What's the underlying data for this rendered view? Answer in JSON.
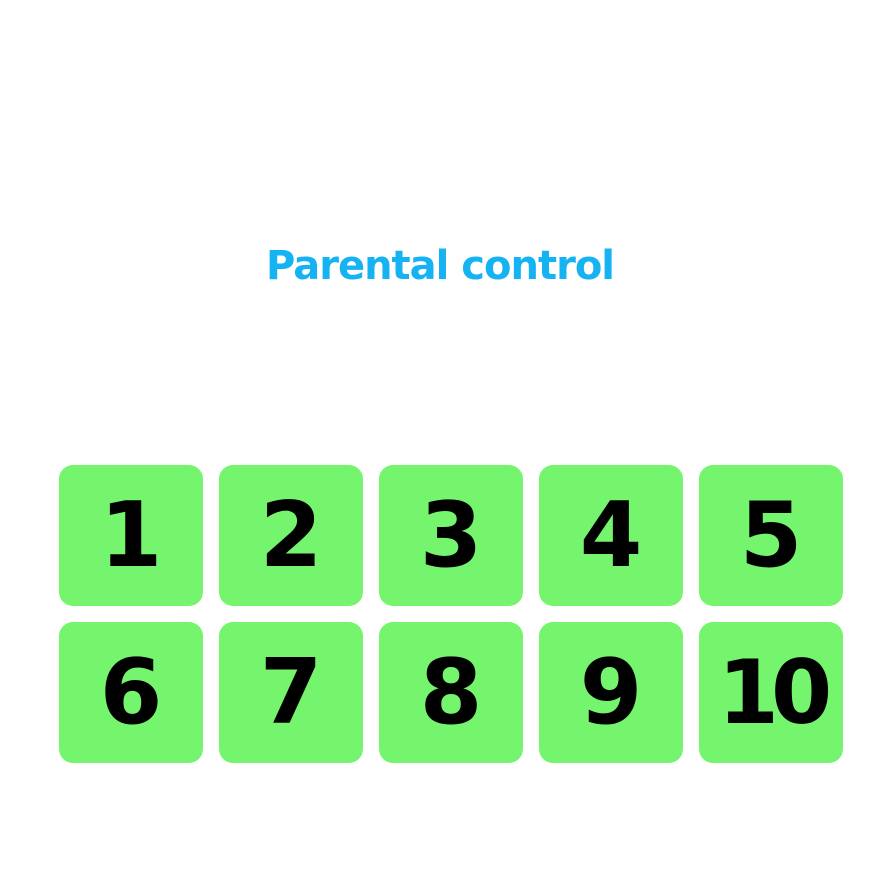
{
  "page": {
    "title": "Parental control"
  },
  "colors": {
    "title": "#16b3f3",
    "key_background": "#74f56d",
    "key_label": "#000000",
    "background": "#ffffff"
  },
  "keypad": {
    "keys": [
      {
        "label": "1"
      },
      {
        "label": "2"
      },
      {
        "label": "3"
      },
      {
        "label": "4"
      },
      {
        "label": "5"
      },
      {
        "label": "6"
      },
      {
        "label": "7"
      },
      {
        "label": "8"
      },
      {
        "label": "9"
      },
      {
        "label": "10"
      }
    ]
  }
}
